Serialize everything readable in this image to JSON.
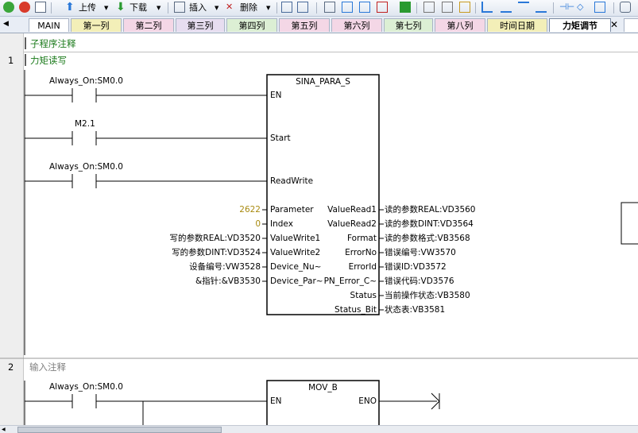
{
  "toolbar": {
    "upload": "上传",
    "download": "下载",
    "insert": "插入",
    "delete": "删除"
  },
  "tabs": [
    "MAIN",
    "第一列",
    "第二列",
    "第三列",
    "第四列",
    "第五列",
    "第六列",
    "第七列",
    "第八列",
    "时间日期",
    "力矩调节"
  ],
  "colors": {
    "tab_pink": "#f4d7e6",
    "tab_green": "#dcefd4",
    "tab_yellow": "#f3efb8",
    "active_tab": "#ffffff"
  },
  "editor": {
    "subroutine_comment": "子程序注释",
    "network1": {
      "number": "1",
      "title": "力矩读写",
      "contact1": "Always_On:SM0.0",
      "contact2": "M2.1",
      "contact3": "Always_On:SM0.0",
      "block_name": "SINA_PARA_S",
      "en": "EN",
      "inputs": [
        "Start",
        "ReadWrite",
        "Parameter",
        "Index",
        "ValueWrite1",
        "ValueWrite2",
        "Device_Nu~",
        "Device_Par~"
      ],
      "param_value": "2622",
      "index_value": "0",
      "in_vars": [
        "写的参数REAL:VD3520",
        "写的参数DINT:VD3524",
        "设备编号:VW3528",
        "&指针:&VB3530"
      ],
      "outputs": [
        "ValueRead1",
        "ValueRead2",
        "Format",
        "ErrorNo",
        "ErrorId",
        "PN_Error_C~",
        "Status",
        "Status_Bit"
      ],
      "out_vars": [
        "读的参数REAL:VD3560",
        "读的参数DINT:VD3564",
        "读的参数格式:VB3568",
        "错误编号:VW3570",
        "错误ID:VD3572",
        "错误代码:VD3576",
        "当前操作状态:VB3580",
        "状态表:VB3581"
      ]
    },
    "network2": {
      "number": "2",
      "title": "输入注释",
      "contact1": "Always_On:SM0.0",
      "block_name": "MOV_B",
      "en": "EN",
      "eno": "ENO"
    }
  }
}
